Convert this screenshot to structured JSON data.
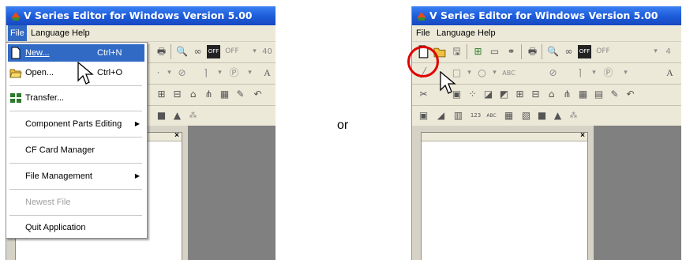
{
  "window": {
    "title": "V Series Editor for Windows Version 5.00",
    "menu": [
      "File",
      "Language",
      "Help"
    ]
  },
  "toolbar": {
    "off_label": "OFF",
    "zoom_value": "40",
    "zoom_value_right": "4",
    "letter_a": "A",
    "letter_p": "P",
    "abc": "ABC",
    "digits": "123"
  },
  "file_menu": {
    "items": [
      {
        "label": "New...",
        "shortcut": "Ctrl+N"
      },
      {
        "label": "Open...",
        "shortcut": "Ctrl+O"
      },
      {
        "label": "Transfer..."
      },
      {
        "label": "Component Parts Editing"
      },
      {
        "label": "CF Card Manager"
      },
      {
        "label": "File Management"
      },
      {
        "label": "Newest File"
      },
      {
        "label": "Quit Application"
      }
    ]
  },
  "separator_text": "or",
  "colors": {
    "titlebar": "#1d5bd8",
    "highlight": "#316ac5",
    "circle": "#e00000"
  },
  "icons": [
    "new-file-icon",
    "open-folder-icon",
    "transfer-icon",
    "cursor-arrow-icon",
    "close-icon"
  ]
}
